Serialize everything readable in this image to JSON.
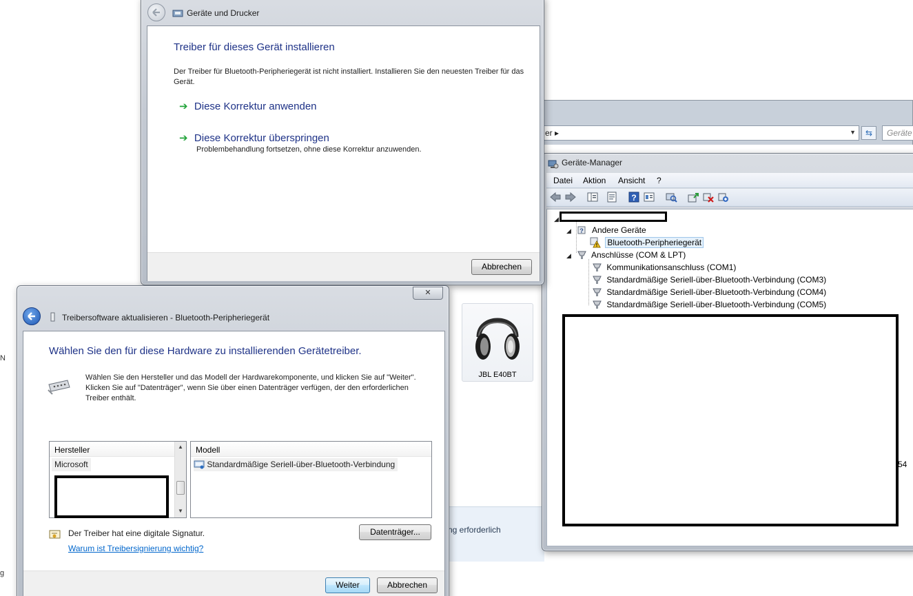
{
  "devices_printers": {
    "title": "Geräte und Drucker",
    "heading": "Treiber für dieses Gerät installieren",
    "description": "Der Treiber für Bluetooth-Peripheriegerät ist nicht installiert. Installieren Sie den neuesten Treiber für das Gerät.",
    "option_apply": "Diese Korrektur anwenden",
    "option_skip": "Diese Korrektur überspringen",
    "option_skip_sub": "Problembehandlung fortsetzen, ohne diese Korrektur anzuwenden.",
    "cancel": "Abbrechen"
  },
  "background": {
    "breadcrumb_fragment": "er ▸",
    "search_placeholder": "Geräte",
    "device_name": "JBL E40BT",
    "status_fragment": "ng erforderlich",
    "edge_number": "54",
    "left_edge_n": "N",
    "left_edge_g": "g"
  },
  "device_manager": {
    "title": "Geräte-Manager",
    "menu": [
      "Datei",
      "Aktion",
      "Ansicht",
      "?"
    ],
    "tree": {
      "other_devices": "Andere Geräte",
      "bt_peripheral": "Bluetooth-Peripheriegerät",
      "ports": "Anschlüsse (COM & LPT)",
      "com1": "Kommunikationsanschluss (COM1)",
      "com3": "Standardmäßige Seriell-über-Bluetooth-Verbindung (COM3)",
      "com4": "Standardmäßige Seriell-über-Bluetooth-Verbindung (COM4)",
      "com5": "Standardmäßige Seriell-über-Bluetooth-Verbindung (COM5)"
    }
  },
  "driver_update": {
    "title": "Treibersoftware aktualisieren - Bluetooth-Peripheriegerät",
    "heading": "Wählen Sie den für diese Hardware zu installierenden Gerätetreiber.",
    "instruction": "Wählen Sie den Hersteller und das Modell der Hardwarekomponente, und klicken Sie auf \"Weiter\". Klicken Sie auf \"Datenträger\", wenn Sie über einen Datenträger verfügen, der den erforderlichen Treiber enthält.",
    "manufacturer_header": "Hersteller",
    "manufacturers": [
      "Microsoft"
    ],
    "model_header": "Modell",
    "models": [
      "Standardmäßige Seriell-über-Bluetooth-Verbindung"
    ],
    "signature_text": "Der Treiber hat eine digitale Signatur.",
    "signature_link": "Warum ist Treibersignierung wichtig?",
    "have_disk": "Datenträger...",
    "next": "Weiter",
    "cancel": "Abbrechen",
    "close_glyph": "✕"
  }
}
